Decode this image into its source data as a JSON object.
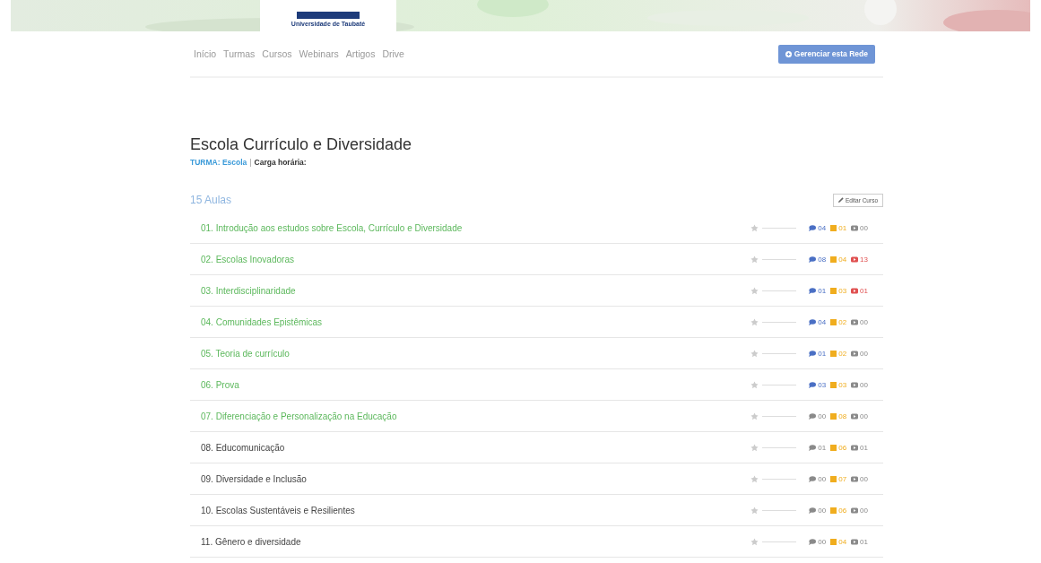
{
  "header": {
    "logo_caption": "Universidade de Taubaté"
  },
  "nav": {
    "links": [
      {
        "label": "Início"
      },
      {
        "label": "Turmas"
      },
      {
        "label": "Cursos"
      },
      {
        "label": "Webinars"
      },
      {
        "label": "Artigos"
      },
      {
        "label": "Drive"
      }
    ],
    "manage_button": "Gerenciar esta Rede"
  },
  "course": {
    "title": "Escola Currículo e Diversidade",
    "turma_label": "TURMA: Escola",
    "separator": "|",
    "workload_label": "Carga horária:"
  },
  "lessons_header": {
    "count": "15 Aulas",
    "edit_button": "Editar Curso"
  },
  "lessons": [
    {
      "title": "01. Introdução aos estudos sobre Escola, Currículo e Diversidade",
      "completed": true,
      "stats": [
        {
          "kind": "comments",
          "value": "04",
          "active": true
        },
        {
          "kind": "files",
          "value": "01",
          "active": true
        },
        {
          "kind": "videos",
          "value": "00",
          "active": false
        }
      ]
    },
    {
      "title": "02. Escolas Inovadoras",
      "completed": true,
      "stats": [
        {
          "kind": "comments",
          "value": "08",
          "active": true
        },
        {
          "kind": "files",
          "value": "04",
          "active": true
        },
        {
          "kind": "videos",
          "value": "13",
          "active": true
        }
      ]
    },
    {
      "title": "03. Interdisciplinaridade",
      "completed": true,
      "stats": [
        {
          "kind": "comments",
          "value": "01",
          "active": true
        },
        {
          "kind": "files",
          "value": "03",
          "active": true
        },
        {
          "kind": "videos",
          "value": "01",
          "active": true
        }
      ]
    },
    {
      "title": "04. Comunidades Epistêmicas",
      "completed": true,
      "stats": [
        {
          "kind": "comments",
          "value": "04",
          "active": true
        },
        {
          "kind": "files",
          "value": "02",
          "active": true
        },
        {
          "kind": "videos",
          "value": "00",
          "active": false
        }
      ]
    },
    {
      "title": "05. Teoria de currículo",
      "completed": true,
      "stats": [
        {
          "kind": "comments",
          "value": "01",
          "active": true
        },
        {
          "kind": "files",
          "value": "02",
          "active": true
        },
        {
          "kind": "videos",
          "value": "00",
          "active": false
        }
      ]
    },
    {
      "title": "06. Prova",
      "completed": true,
      "stats": [
        {
          "kind": "comments",
          "value": "03",
          "active": true
        },
        {
          "kind": "files",
          "value": "03",
          "active": true
        },
        {
          "kind": "videos",
          "value": "00",
          "active": false
        }
      ]
    },
    {
      "title": "07. Diferenciação e Personalização na Educação",
      "completed": true,
      "stats": [
        {
          "kind": "comments",
          "value": "00",
          "active": false
        },
        {
          "kind": "files",
          "value": "08",
          "active": true
        },
        {
          "kind": "videos",
          "value": "00",
          "active": false
        }
      ]
    },
    {
      "title": "08. Educomunicação",
      "completed": false,
      "stats": [
        {
          "kind": "comments",
          "value": "01",
          "active": false
        },
        {
          "kind": "files",
          "value": "06",
          "active": true
        },
        {
          "kind": "videos",
          "value": "01",
          "active": false
        }
      ]
    },
    {
      "title": "09. Diversidade e Inclusão",
      "completed": false,
      "stats": [
        {
          "kind": "comments",
          "value": "00",
          "active": false
        },
        {
          "kind": "files",
          "value": "07",
          "active": true
        },
        {
          "kind": "videos",
          "value": "00",
          "active": false
        }
      ]
    },
    {
      "title": "10. Escolas Sustentáveis e Resilientes",
      "completed": false,
      "stats": [
        {
          "kind": "comments",
          "value": "00",
          "active": false
        },
        {
          "kind": "files",
          "value": "06",
          "active": true
        },
        {
          "kind": "videos",
          "value": "00",
          "active": false
        }
      ]
    },
    {
      "title": "11. Gênero e diversidade",
      "completed": false,
      "stats": [
        {
          "kind": "comments",
          "value": "00",
          "active": false
        },
        {
          "kind": "files",
          "value": "04",
          "active": true
        },
        {
          "kind": "videos",
          "value": "01",
          "active": false
        }
      ]
    }
  ]
}
